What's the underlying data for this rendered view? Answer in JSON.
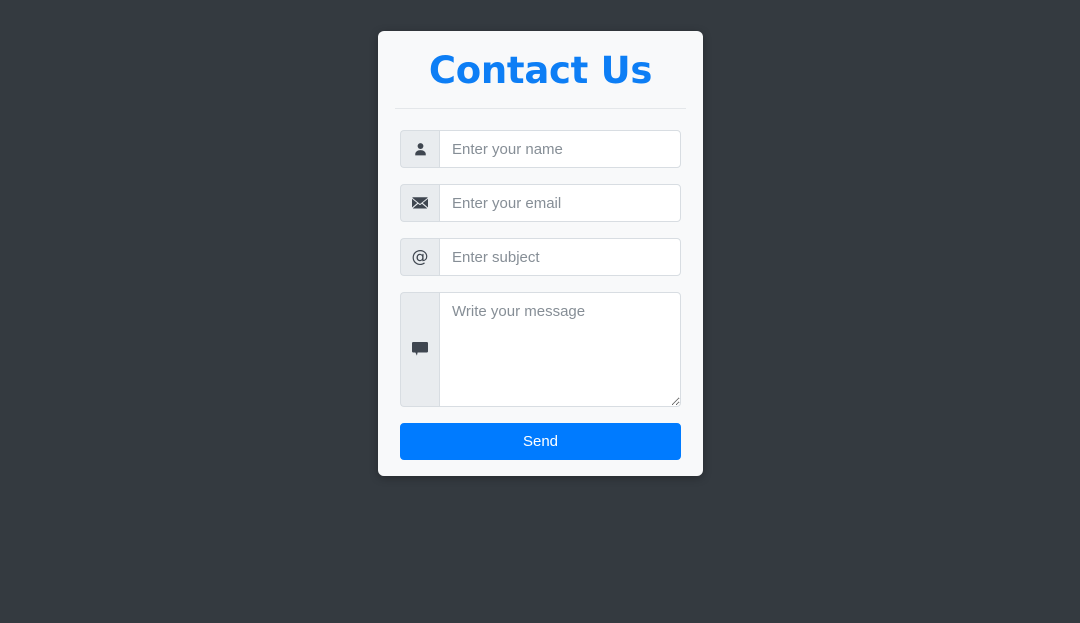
{
  "page": {
    "background_color": "#343a40"
  },
  "card": {
    "title": "Contact Us",
    "title_color": "#0d7ef5",
    "background_color": "#f8f9fa"
  },
  "form": {
    "fields": [
      {
        "id": "name",
        "icon": "user-icon",
        "placeholder": "Enter your name",
        "value": "",
        "type": "text"
      },
      {
        "id": "email",
        "icon": "envelope-icon",
        "placeholder": "Enter your email",
        "value": "",
        "type": "email"
      },
      {
        "id": "subject",
        "icon": "at-sign-icon",
        "icon_glyph": "@",
        "placeholder": "Enter subject",
        "value": "",
        "type": "text"
      },
      {
        "id": "message",
        "icon": "comment-icon",
        "placeholder": "Write your message",
        "value": "",
        "type": "textarea"
      }
    ],
    "submit": {
      "label": "Send",
      "color": "#007bff",
      "text_color": "#ffffff"
    }
  }
}
